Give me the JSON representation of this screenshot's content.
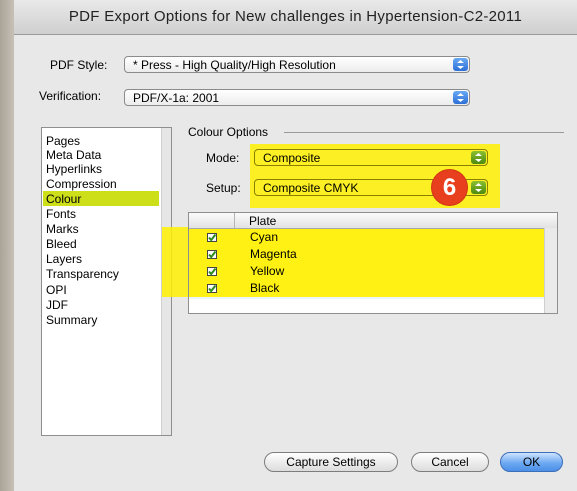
{
  "window": {
    "title": "PDF Export Options for New challenges in Hypertension-C2-2011"
  },
  "pdf_style": {
    "label": "PDF Style:",
    "value": "* Press - High Quality/High Resolution"
  },
  "verification": {
    "label": "Verification:",
    "value": "PDF/X-1a: 2001"
  },
  "sidebar": {
    "selected": "Colour",
    "items": [
      "Pages",
      "Meta Data",
      "Hyperlinks",
      "Compression",
      "Colour",
      "Fonts",
      "Marks",
      "Bleed",
      "Layers",
      "Transparency",
      "OPI",
      "JDF",
      "Summary"
    ]
  },
  "colour_options": {
    "title": "Colour Options",
    "mode_label": "Mode:",
    "mode_value": "Composite",
    "setup_label": "Setup:",
    "setup_value": "Composite CMYK"
  },
  "plate_table": {
    "header": "Plate",
    "rows": [
      {
        "name": "Cyan",
        "checked": true
      },
      {
        "name": "Magenta",
        "checked": true
      },
      {
        "name": "Yellow",
        "checked": true
      },
      {
        "name": "Black",
        "checked": true
      }
    ]
  },
  "buttons": {
    "capture": "Capture Settings",
    "cancel": "Cancel",
    "ok": "OK"
  },
  "annotation": {
    "number": "6"
  },
  "colors": {
    "highlight": "#fff000",
    "badge": "#e8401f",
    "checkmark": "#2f8a1c",
    "stepper": "#2c6fd6"
  }
}
